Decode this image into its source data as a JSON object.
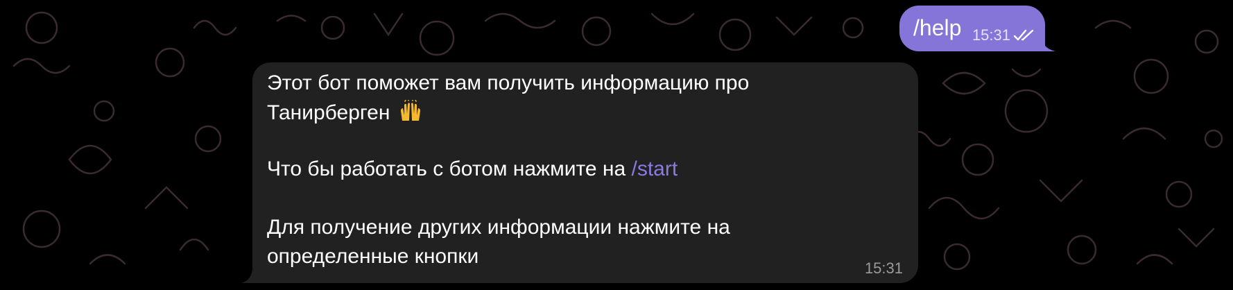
{
  "outgoing": {
    "text": "/help",
    "time": "15:31",
    "status_icon": "double-check-icon"
  },
  "incoming": {
    "line1": "Этот бот поможет вам получить информацию про",
    "line2": "Танирберген",
    "line2_emoji": "raising-hands-emoji",
    "line3_prefix": "Что бы работать с ботом нажмите на ",
    "line3_command": "/start",
    "line4": "Для получение других информации нажмите на",
    "line5": "определенные кнопки",
    "time": "15:31"
  },
  "colors": {
    "background": "#000000",
    "outgoing_bubble": "#8675d8",
    "incoming_bubble": "#212121",
    "link": "#8a7be0",
    "doodle": "#3a2a32"
  }
}
